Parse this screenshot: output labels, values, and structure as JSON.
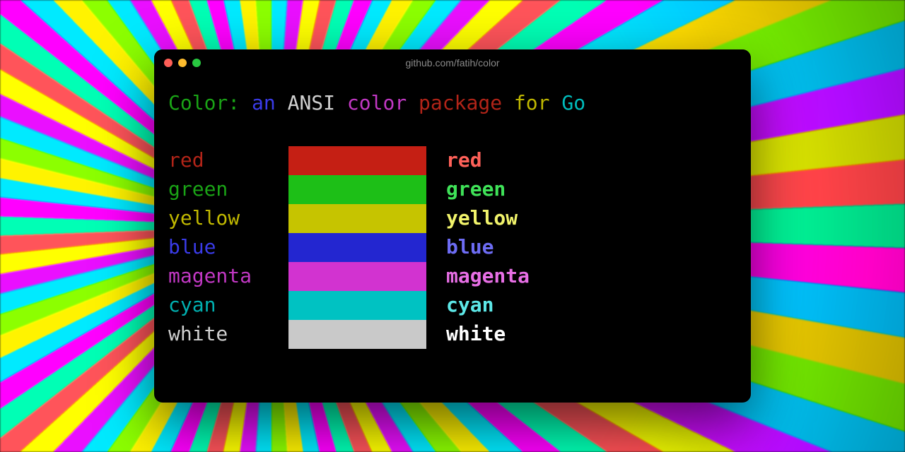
{
  "window": {
    "title": "github.com/fatih/color"
  },
  "headline": {
    "prefix": "Color:",
    "words": [
      {
        "text": "an",
        "color": "#3a3be8"
      },
      {
        "text": "ANSI",
        "color": "#d0d0d0"
      },
      {
        "text": "color",
        "color": "#c238c4"
      },
      {
        "text": "package",
        "color": "#b22418"
      },
      {
        "text": "for",
        "color": "#c0b800"
      },
      {
        "text": "Go",
        "color": "#00bdbd"
      }
    ],
    "prefix_color": "#1aa316"
  },
  "colors": [
    {
      "name": "red",
      "normal": "#b22418",
      "swatch": "#c51f14",
      "bright": "#ff6159"
    },
    {
      "name": "green",
      "normal": "#1aa316",
      "swatch": "#1dbf17",
      "bright": "#3fe258"
    },
    {
      "name": "yellow",
      "normal": "#c0b800",
      "swatch": "#c6c400",
      "bright": "#f1f36b"
    },
    {
      "name": "blue",
      "normal": "#3a3be8",
      "swatch": "#2326d0",
      "bright": "#6d6cf4"
    },
    {
      "name": "magenta",
      "normal": "#c238c4",
      "swatch": "#d233d0",
      "bright": "#e86fe6"
    },
    {
      "name": "cyan",
      "normal": "#00b0b0",
      "swatch": "#00c2c2",
      "bright": "#5de8e8"
    },
    {
      "name": "white",
      "normal": "#d0d0d0",
      "swatch": "#c9c9c9",
      "bright": "#ffffff"
    }
  ]
}
